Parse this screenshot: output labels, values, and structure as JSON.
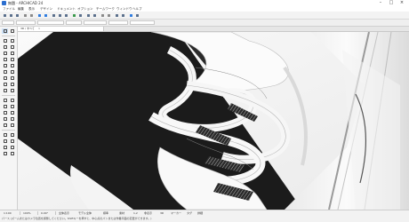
{
  "window": {
    "title": "無題 - ARCHICAD 24",
    "controls": [
      "–",
      "□",
      "×"
    ]
  },
  "menubar": {
    "items": [
      "ファイル",
      "編集",
      "表示",
      "デザイン",
      "ドキュメント",
      "オプション",
      "チームワーク",
      "ウィンドウ",
      "ヘルプ"
    ]
  },
  "tabs": [
    {
      "label": "3D / すべて",
      "close": "×"
    }
  ],
  "statusbar": {
    "message": "パース (ズームまたはカメラ位置を調整してください。Shiftキーを押すと、中心点のパンまたは作業平面の変更ができます。)",
    "items": [
      "1:100",
      "100%",
      "0.00°",
      "全体表示",
      "モデル全体",
      "標準",
      "素材",
      "1,2",
      "非表示",
      "3D",
      "マーカー",
      "タグ",
      "詳細"
    ]
  },
  "colors": {
    "accent": "#2f7de0",
    "viewport_bg": "#f5f5f5",
    "floor": "#1b1b1b",
    "ribbon": "#fbfbfb"
  }
}
